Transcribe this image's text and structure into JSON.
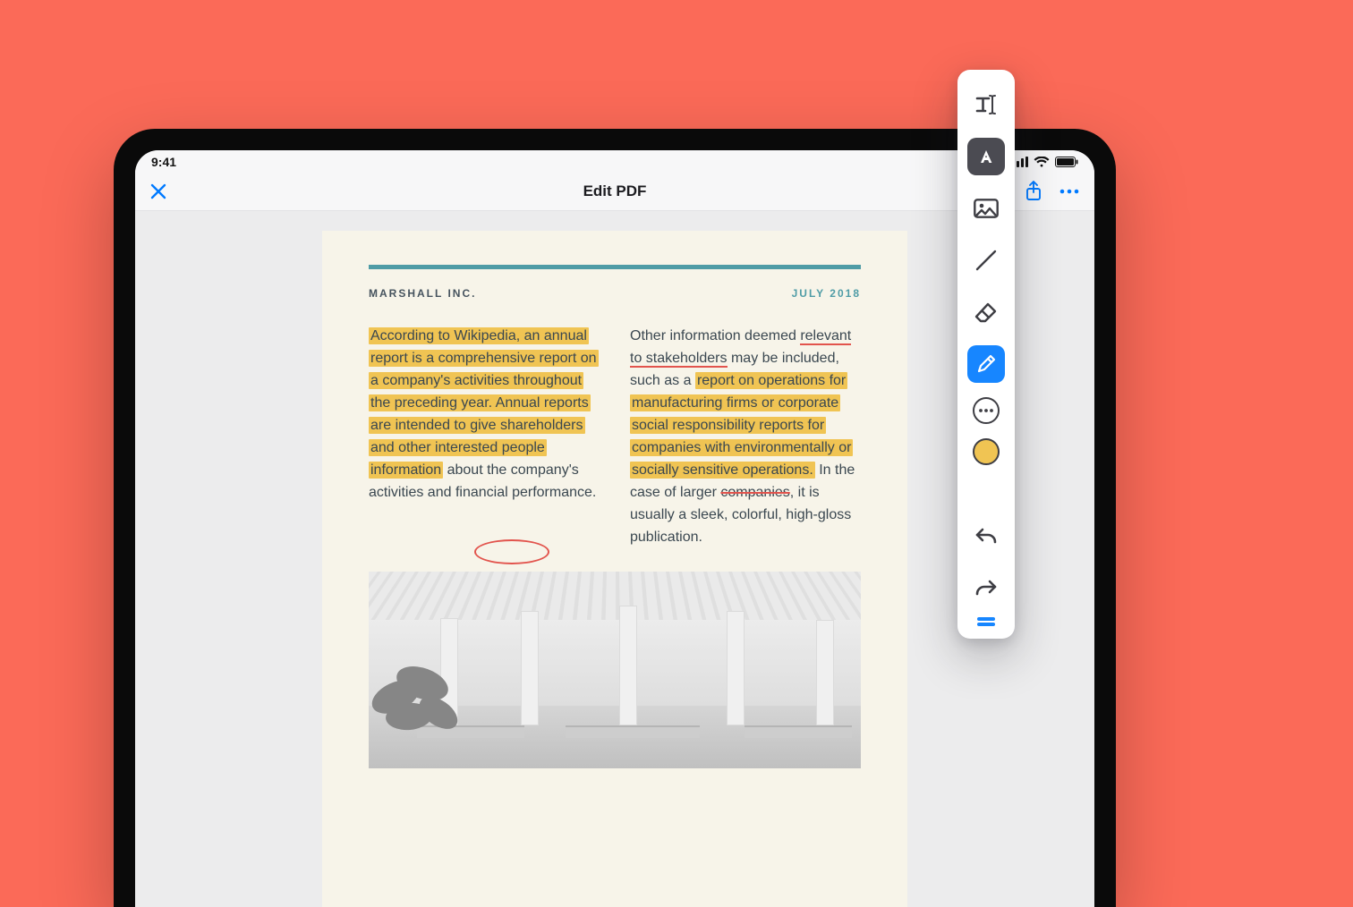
{
  "colors": {
    "background": "#fb6a58",
    "ios_blue": "#007aff",
    "highlight": "#f0c453",
    "annotation_red": "#e2544d",
    "accent_teal": "#4f9ca6",
    "page_bg": "#f7f4e9"
  },
  "statusbar": {
    "time": "9:41"
  },
  "navbar": {
    "title": "Edit PDF"
  },
  "document": {
    "company": "MARSHALL INC.",
    "date": "JULY 2018",
    "col1": {
      "p1_hl1": "According to Wikipedia, an annual report is a comprehensive report on a company's activities throughout the preceding year. Annual reports are intended to give shareholders and other interested people information",
      "p1_tail1": " about the company's activities and ",
      "p1_circled": "financial",
      "p1_tail2": " performance."
    },
    "col2": {
      "p2_a": "Other information deemed ",
      "p2_underlined": "relevant to stakeholders",
      "p2_b": " may be included, such as a ",
      "p2_hl2": "report on operations for manufacturing firms or corporate social responsibility reports for companies with environmentally or socially sensitive operations.",
      "p2_c": " In the case of larger ",
      "p2_strike": "companies",
      "p2_d": ", it is usually a sleek, colorful, high-gloss publication."
    }
  },
  "palette": {
    "tools": [
      {
        "name": "text-cursor-tool"
      },
      {
        "name": "text-box-tool"
      },
      {
        "name": "image-tool"
      },
      {
        "name": "line-tool"
      },
      {
        "name": "eraser-tool"
      },
      {
        "name": "pen-tool"
      },
      {
        "name": "more-tool"
      },
      {
        "name": "color-swatch"
      },
      {
        "name": "undo"
      },
      {
        "name": "redo"
      },
      {
        "name": "drag-handle"
      }
    ]
  }
}
